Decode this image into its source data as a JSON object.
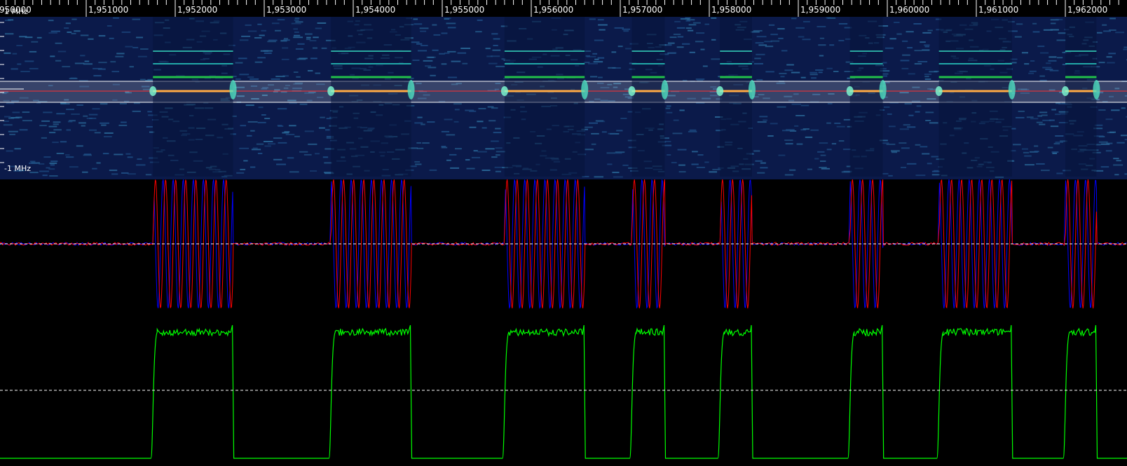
{
  "app": {
    "time_axis": {
      "ticks": [
        {
          "value": 1950000,
          "label": "950000"
        },
        {
          "value": 1951000,
          "label": "1,951000"
        },
        {
          "value": 1952000,
          "label": "1,952000"
        },
        {
          "value": 1953000,
          "label": "1,953000"
        },
        {
          "value": 1954000,
          "label": "1,954000"
        },
        {
          "value": 1955000,
          "label": "1,955000"
        },
        {
          "value": 1956000,
          "label": "1,956000"
        },
        {
          "value": 1957000,
          "label": "1,957000"
        },
        {
          "value": 1958000,
          "label": "1,958000"
        },
        {
          "value": 1959000,
          "label": "1,959000"
        },
        {
          "value": 1960000,
          "label": "1,960000"
        },
        {
          "value": 1961000,
          "label": "1,961000"
        },
        {
          "value": 1962000,
          "label": "1,962000"
        }
      ]
    },
    "spectrogram": {
      "freq_top_label": "1 MHz",
      "freq_bottom_label": "-1 MHz"
    },
    "colors": {
      "spectrogram_bg": "#0b1a4a",
      "tuning_line": "#ff3030",
      "waveform_i": "#0000ff",
      "waveform_q": "#ff0000",
      "amplitude": "#00ff00",
      "carrier": "#ffaa44"
    },
    "signal": {
      "bursts": [
        {
          "start": 1951750,
          "end": 1952650
        },
        {
          "start": 1953750,
          "end": 1954650
        },
        {
          "start": 1955700,
          "end": 1956600
        },
        {
          "start": 1957130,
          "end": 1957500
        },
        {
          "start": 1958120,
          "end": 1958480
        },
        {
          "start": 1959580,
          "end": 1959950
        },
        {
          "start": 1960580,
          "end": 1961400
        },
        {
          "start": 1962000,
          "end": 1962350
        }
      ]
    }
  }
}
